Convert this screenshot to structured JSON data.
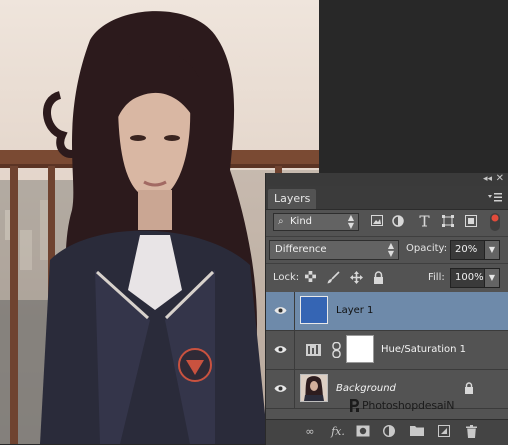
{
  "panel": {
    "tab_label": "Layers",
    "collapse_glyph": "◂◂",
    "close_glyph": "✕",
    "filter": {
      "kind_label": "Kind"
    },
    "blend_mode": "Difference",
    "opacity_label": "Opacity:",
    "opacity_value": "20%",
    "lock_label": "Lock:",
    "fill_label": "Fill:",
    "fill_value": "100%",
    "layers": [
      {
        "name": "Layer 1",
        "selected": true,
        "thumb_color": "#3565b4"
      },
      {
        "name": "Hue/Saturation 1",
        "selected": false,
        "type": "adjustment"
      },
      {
        "name": "Background",
        "selected": false,
        "locked": true
      }
    ]
  },
  "icons": {
    "filter_pixel": "image-icon",
    "filter_adjust": "half-circle-icon",
    "filter_type": "type-icon",
    "filter_shape": "shape-icon",
    "filter_smart": "smart-object-icon",
    "lock_pixels": "checker-icon",
    "lock_paint": "brush-icon",
    "lock_position": "move-icon",
    "lock_all": "lock-icon"
  },
  "watermark": {
    "text": "PhotoshopdesaiN"
  },
  "colors": {
    "selection": "#6e8aaa",
    "panel_bg": "#535353",
    "layer1_fill": "#3565b4"
  }
}
